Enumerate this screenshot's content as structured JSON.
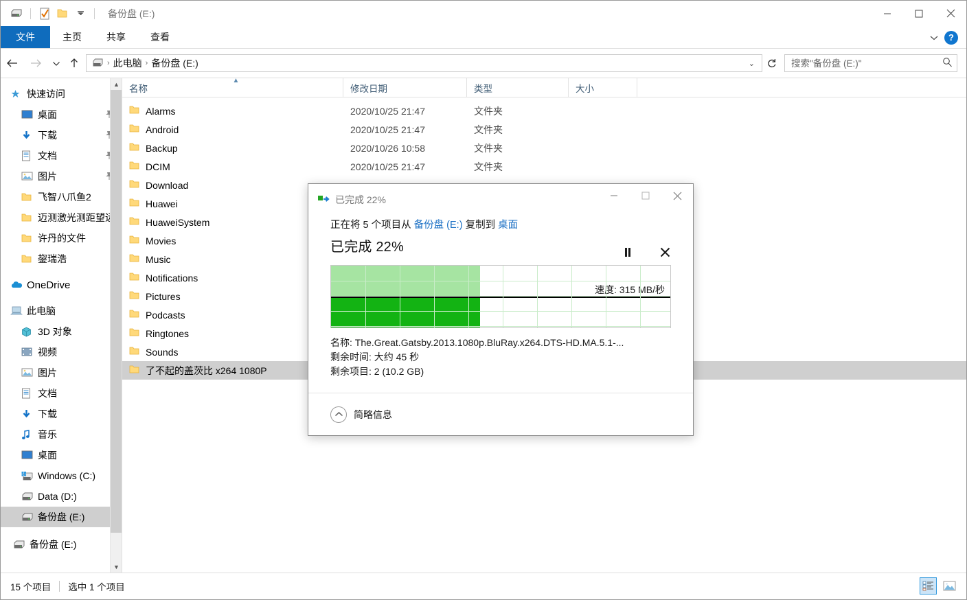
{
  "window": {
    "title": "备份盘 (E:)",
    "minimize": "—",
    "maximize": "□",
    "close": "✕"
  },
  "quick_access_toolbar": {
    "drive_icon": "drive-icon",
    "properties_icon": "properties-checkmark-icon",
    "new_folder_icon": "new-folder-icon",
    "dropdown_icon": "chevron-down-icon"
  },
  "ribbon": {
    "tabs": [
      {
        "label": "文件",
        "active": true
      },
      {
        "label": "主页",
        "active": false
      },
      {
        "label": "共享",
        "active": false
      },
      {
        "label": "查看",
        "active": false
      }
    ],
    "collapse_icon": "chevron-down-icon",
    "help_label": "?"
  },
  "address_bar": {
    "back_icon": "arrow-left-icon",
    "forward_icon": "arrow-right-icon",
    "recent_icon": "chevron-down-icon",
    "up_icon": "arrow-up-icon",
    "breadcrumb": [
      "此电脑",
      "备份盘 (E:)"
    ],
    "separator": "›",
    "dropdown_icon": "chevron-down-icon",
    "refresh_icon": "refresh-icon"
  },
  "search": {
    "placeholder": "搜索\"备份盘 (E:)\"",
    "value": "",
    "icon": "search-icon"
  },
  "sidebar": {
    "items": [
      {
        "label": "快速访问",
        "icon": "pin-star-icon",
        "level": 0,
        "pinned": false,
        "selected": false
      },
      {
        "label": "桌面",
        "icon": "desktop-icon",
        "level": 1,
        "pinned": true,
        "selected": false
      },
      {
        "label": "下载",
        "icon": "download-icon",
        "level": 1,
        "pinned": true,
        "selected": false
      },
      {
        "label": "文档",
        "icon": "documents-icon",
        "level": 1,
        "pinned": true,
        "selected": false
      },
      {
        "label": "图片",
        "icon": "pictures-icon",
        "level": 1,
        "pinned": true,
        "selected": false
      },
      {
        "label": "飞智八爪鱼2",
        "icon": "folder-icon",
        "level": 1,
        "pinned": false,
        "selected": false
      },
      {
        "label": "迈测激光测距望远",
        "icon": "folder-icon",
        "level": 1,
        "pinned": false,
        "selected": false
      },
      {
        "label": "许丹的文件",
        "icon": "folder-icon",
        "level": 1,
        "pinned": false,
        "selected": false
      },
      {
        "label": "鋆瑞浩",
        "icon": "folder-icon",
        "level": 1,
        "pinned": false,
        "selected": false
      },
      {
        "label": "OneDrive",
        "icon": "onedrive-cloud-icon",
        "level": 0,
        "pinned": false,
        "selected": false
      },
      {
        "label": "此电脑",
        "icon": "this-pc-icon",
        "level": 0,
        "pinned": false,
        "selected": false
      },
      {
        "label": "3D 对象",
        "icon": "3d-objects-icon",
        "level": 1,
        "pinned": false,
        "selected": false
      },
      {
        "label": "视频",
        "icon": "videos-icon",
        "level": 1,
        "pinned": false,
        "selected": false
      },
      {
        "label": "图片",
        "icon": "pictures-icon",
        "level": 1,
        "pinned": false,
        "selected": false
      },
      {
        "label": "文档",
        "icon": "documents-icon",
        "level": 1,
        "pinned": false,
        "selected": false
      },
      {
        "label": "下载",
        "icon": "download-icon",
        "level": 1,
        "pinned": false,
        "selected": false
      },
      {
        "label": "音乐",
        "icon": "music-note-icon",
        "level": 1,
        "pinned": false,
        "selected": false
      },
      {
        "label": "桌面",
        "icon": "desktop-icon",
        "level": 1,
        "pinned": false,
        "selected": false
      },
      {
        "label": "Windows (C:)",
        "icon": "windows-drive-icon",
        "level": 1,
        "pinned": false,
        "selected": false
      },
      {
        "label": "Data (D:)",
        "icon": "drive-icon",
        "level": 1,
        "pinned": false,
        "selected": false
      },
      {
        "label": "备份盘 (E:)",
        "icon": "drive-icon",
        "level": 1,
        "pinned": false,
        "selected": true
      },
      {
        "label": "备份盘 (E:)",
        "icon": "drive-icon",
        "level": 0,
        "pinned": false,
        "selected": false
      }
    ],
    "scroll_up_icon": "chevron-up-icon",
    "scroll_down_icon": "chevron-down-icon"
  },
  "file_list": {
    "columns": [
      {
        "label": "名称",
        "sorted": true
      },
      {
        "label": "修改日期",
        "sorted": false
      },
      {
        "label": "类型",
        "sorted": false
      },
      {
        "label": "大小",
        "sorted": false
      }
    ],
    "sort_caret": "▲",
    "rows": [
      {
        "name": "Alarms",
        "date": "2020/10/25 21:47",
        "type": "文件夹",
        "size": "",
        "selected": false
      },
      {
        "name": "Android",
        "date": "2020/10/25 21:47",
        "type": "文件夹",
        "size": "",
        "selected": false
      },
      {
        "name": "Backup",
        "date": "2020/10/26 10:58",
        "type": "文件夹",
        "size": "",
        "selected": false
      },
      {
        "name": "DCIM",
        "date": "2020/10/25 21:47",
        "type": "文件夹",
        "size": "",
        "selected": false
      },
      {
        "name": "Download",
        "date": "",
        "type": "",
        "size": "",
        "selected": false
      },
      {
        "name": "Huawei",
        "date": "",
        "type": "",
        "size": "",
        "selected": false
      },
      {
        "name": "HuaweiSystem",
        "date": "",
        "type": "",
        "size": "",
        "selected": false
      },
      {
        "name": "Movies",
        "date": "",
        "type": "",
        "size": "",
        "selected": false
      },
      {
        "name": "Music",
        "date": "",
        "type": "",
        "size": "",
        "selected": false
      },
      {
        "name": "Notifications",
        "date": "",
        "type": "",
        "size": "",
        "selected": false
      },
      {
        "name": "Pictures",
        "date": "",
        "type": "",
        "size": "",
        "selected": false
      },
      {
        "name": "Podcasts",
        "date": "",
        "type": "",
        "size": "",
        "selected": false
      },
      {
        "name": "Ringtones",
        "date": "",
        "type": "",
        "size": "",
        "selected": false
      },
      {
        "name": "Sounds",
        "date": "",
        "type": "",
        "size": "",
        "selected": false
      },
      {
        "name": "了不起的盖茨比 x264 1080P",
        "date": "",
        "type": "",
        "size": "",
        "selected": true
      }
    ]
  },
  "status_bar": {
    "item_count": "15 个项目",
    "selection": "选中 1 个项目",
    "details_view_icon": "details-view-icon",
    "large_icons_view_icon": "large-icons-view-icon"
  },
  "copy_dialog": {
    "title": "已完成 22%",
    "title_icon": "copy-progress-icon",
    "minimize": "—",
    "maximize": "□",
    "close": "✕",
    "operation_prefix": "正在将 5 个项目从 ",
    "source": "备份盘 (E:)",
    "operation_middle": " 复制到 ",
    "destination": "桌面",
    "percent_label": "已完成 22%",
    "percent_value": 22,
    "pause_icon": "pause-icon",
    "cancel_icon": "cancel-icon",
    "speed_label": "速度: 315 MB/秒",
    "name_line": "名称: The.Great.Gatsby.2013.1080p.BluRay.x264.DTS-HD.MA.5.1-...",
    "time_line": "剩余时间: 大约 45 秒",
    "items_line": "剩余项目: 2 (10.2 GB)",
    "footer_label": "简略信息",
    "footer_icon": "chevron-up-circle-icon",
    "colors": {
      "fill_light": "#96df92",
      "fill_dark": "#13b313",
      "grid": "#c9ecc9",
      "speed_line": "#000000"
    }
  }
}
